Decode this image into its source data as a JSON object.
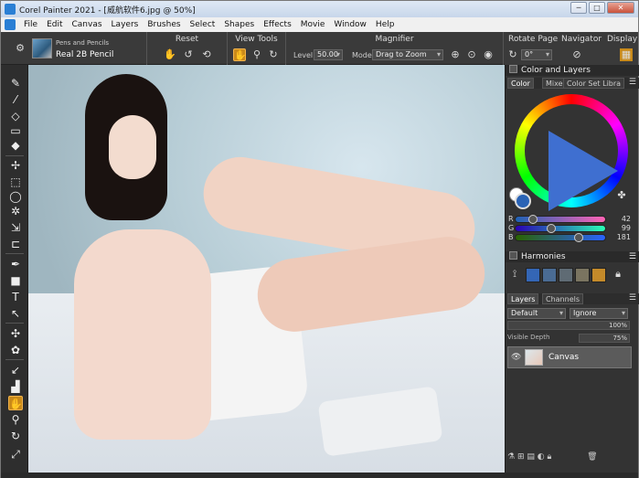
{
  "window": {
    "title": "Corel Painter 2021 - [威航软件6.jpg @ 50%]",
    "controls": {
      "minimize": "─",
      "maximize": "□",
      "close": "✕"
    }
  },
  "menu": [
    "File",
    "Edit",
    "Canvas",
    "Layers",
    "Brushes",
    "Select",
    "Shapes",
    "Effects",
    "Movie",
    "Window",
    "Help"
  ],
  "brush": {
    "category": "Pens and Pencils",
    "variant": "Real 2B Pencil"
  },
  "propbar": {
    "reset_label": "Reset",
    "view_tools_label": "View Tools",
    "magnifier_label": "Magnifier",
    "level_label": "Level:",
    "level_value": "50.00",
    "mode_label": "Mode:",
    "mode_value": "Drag to Zoom",
    "rotate_page_label": "Rotate Page",
    "rotate_value": "0°",
    "navigator_label": "Navigator",
    "display_label": "Display"
  },
  "panels": {
    "color_layers_title": "Color and Layers",
    "color_tabs": [
      "Color",
      "Mixe",
      "Color Set Libra"
    ],
    "rgb": {
      "r_label": "R",
      "r": "42",
      "g_label": "G",
      "g": "99",
      "b_label": "B",
      "b": "181"
    },
    "harmonies_title": "Harmonies",
    "harmony_colors": [
      "#3466b5",
      "#4a6b93",
      "#5f6b74",
      "#7a7460",
      "#c48a2a"
    ],
    "layers_tabs": [
      "Layers",
      "Channels"
    ],
    "composite_method": "Default",
    "composite_depth": "Ignore",
    "opacity": "100%",
    "visible_depth_label": "Visible Depth",
    "visible_depth": "75%",
    "layer_name": "Canvas"
  },
  "colors": {
    "accent": "#c98a1a",
    "main_color": "#2a63b5"
  }
}
